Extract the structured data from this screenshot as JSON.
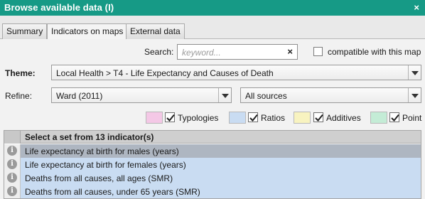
{
  "window": {
    "title": "Browse available data (I)",
    "close_glyph": "×"
  },
  "tabs": [
    {
      "label": "Summary"
    },
    {
      "label": "Indicators on maps"
    },
    {
      "label": "External data"
    }
  ],
  "search": {
    "label": "Search:",
    "placeholder": "keyword...",
    "clear_glyph": "×"
  },
  "compatible": {
    "label": "compatible with this map",
    "checked": false
  },
  "theme": {
    "label": "Theme:",
    "value": "Local Health > T4 - Life Expectancy and Causes of Death"
  },
  "refine": {
    "label": "Refine:",
    "geography": "Ward (2011)",
    "source": "All sources"
  },
  "filters": [
    {
      "label": "Typologies",
      "color": "#f4c8e6",
      "checked": true
    },
    {
      "label": "Ratios",
      "color": "#c9dcf2",
      "checked": true
    },
    {
      "label": "Additives",
      "color": "#f8f3c0",
      "checked": true
    },
    {
      "label": "Point",
      "color": "#c4ecd6",
      "checked": true
    }
  ],
  "table": {
    "header": "Select a set from 13 indicator(s)",
    "rows": [
      {
        "label": "Life expectancy at birth for males (years)",
        "selected": true
      },
      {
        "label": "Life expectancy at birth for females (years)"
      },
      {
        "label": "Deaths from all causes, all ages (SMR)"
      },
      {
        "label": "Deaths from all causes, under 65 years (SMR)"
      }
    ],
    "info_glyph": "i",
    "row_color": "#c9dcf2",
    "selected_color": "#aeb6c1"
  }
}
